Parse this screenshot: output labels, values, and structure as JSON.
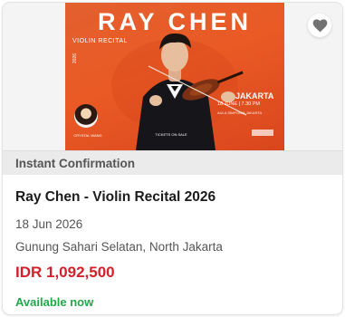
{
  "poster": {
    "title": "RAY CHEN",
    "subtitle": "VIOLIN RECITAL",
    "year": "2026",
    "city": "JAKARTA",
    "date_info": "18 JUNE | 7.30 PM",
    "venue": "AULA SIMFONIA JAKARTA",
    "tickets": "TICKETS ON SALE",
    "guest_name": "CRYSTAL WANG"
  },
  "card": {
    "banner": "Instant Confirmation",
    "name": "Ray Chen - Violin Recital 2026",
    "date": "18 Jun 2026",
    "location": "Gunung Sahari Selatan, North Jakarta",
    "price": "IDR 1,092,500",
    "availability": "Available now"
  },
  "icons": {
    "favorite": "heart-icon"
  },
  "colors": {
    "price": "#d3202a",
    "available": "#22a84a",
    "poster_bg": "#e85a26",
    "banner_bg": "#ebebeb"
  }
}
